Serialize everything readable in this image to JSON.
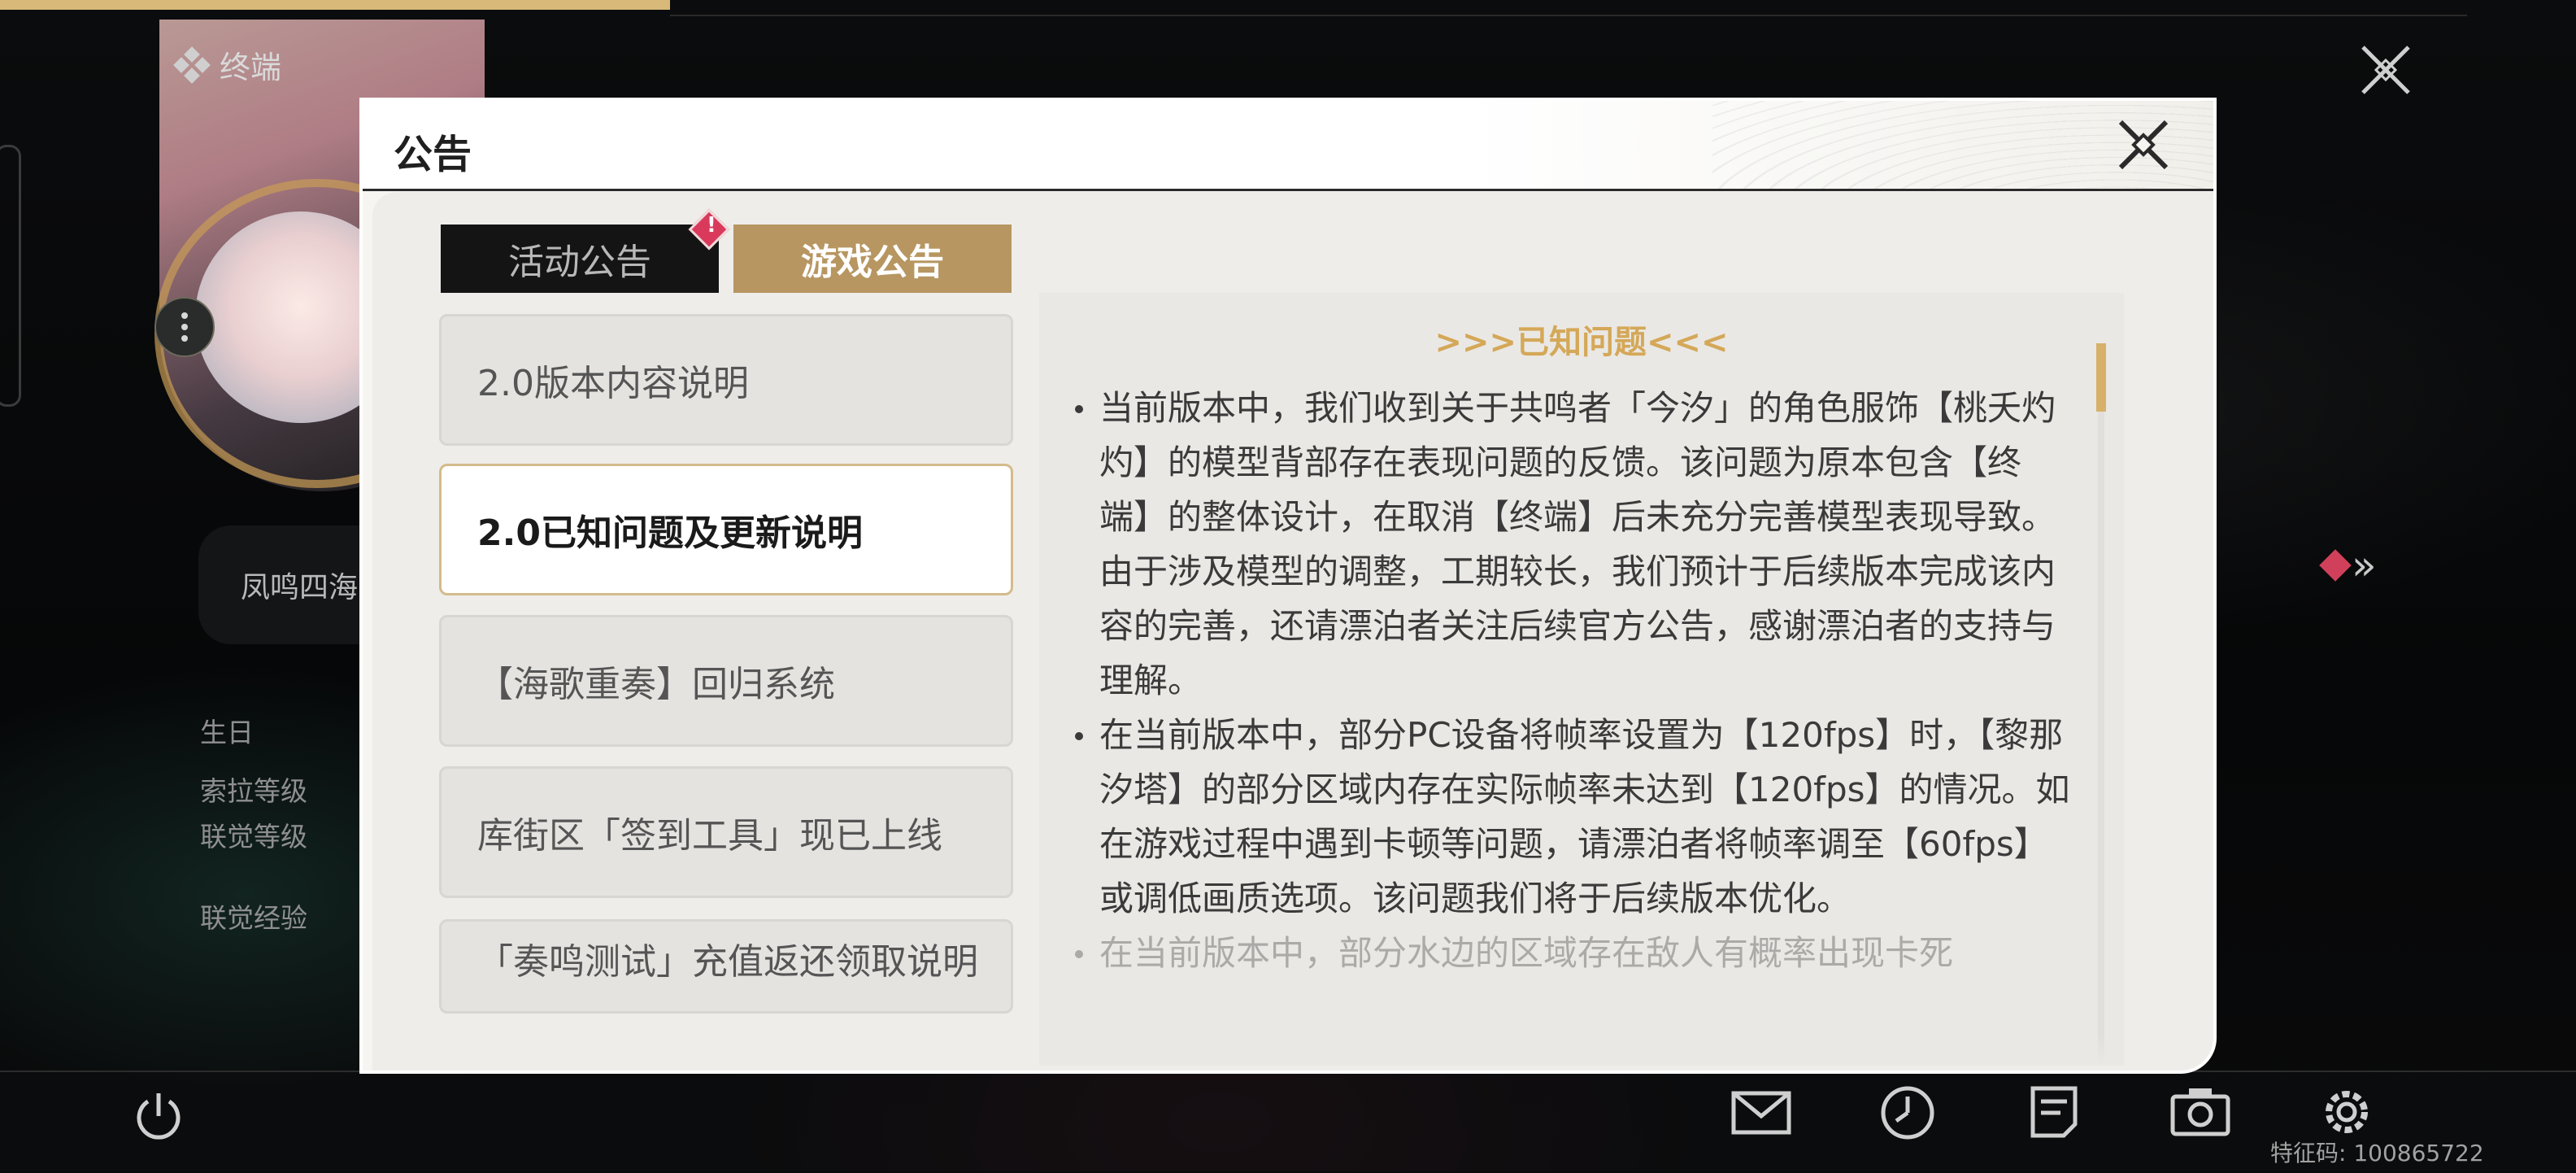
{
  "background": {
    "terminal_label": "终端",
    "name_box_text": "凤鸣四海",
    "stats": [
      "生日",
      "索拉等级",
      "联觉等级",
      "联觉经验"
    ],
    "feature_code": "特征码: 100865722"
  },
  "dialog": {
    "title": "公告",
    "tabs": [
      {
        "label": "活动公告",
        "active": false,
        "badge": "!"
      },
      {
        "label": "游戏公告",
        "active": true
      }
    ],
    "items": [
      {
        "label": "2.0版本内容说明",
        "selected": false
      },
      {
        "label": "2.0已知问题及更新说明",
        "selected": true
      },
      {
        "label": "【海歌重奏】回归系统",
        "selected": false
      },
      {
        "label": "库街区「签到工具」现已上线",
        "selected": false
      },
      {
        "label": "「奏鸣测试」充值返还领取说明",
        "selected": false
      }
    ],
    "content": {
      "heading": ">>>已知问题<<<",
      "paragraphs": [
        "当前版本中，我们收到关于共鸣者「今汐」的角色服饰【桃夭灼灼】的模型背部存在表现问题的反馈。该问题为原本包含【终端】的整体设计，在取消【终端】后未充分完善模型表现导致。由于涉及模型的调整，工期较长，我们预计于后续版本完成该内容的完善，还请漂泊者关注后续官方公告，感谢漂泊者的支持与理解。",
        "在当前版本中，部分PC设备将帧率设置为【120fps】时，【黎那汐塔】的部分区域内存在实际帧率未达到【120fps】的情况。如在游戏过程中遇到卡顿等问题，请漂泊者将帧率调至【60fps】或调低画质选项。该问题我们将于后续版本优化。",
        "在当前版本中，部分水边的区域存在敌人有概率出现卡死"
      ]
    }
  },
  "colors": {
    "accent_gold": "#b79661",
    "heading_gold": "#d4a858",
    "badge_red": "#d93a5c",
    "tab_dark": "#141415"
  },
  "icons": [
    "close-icon",
    "power-icon",
    "mail-icon",
    "clock-icon",
    "notice-icon",
    "camera-icon",
    "gear-icon",
    "terminal-icon",
    "more-icon"
  ]
}
